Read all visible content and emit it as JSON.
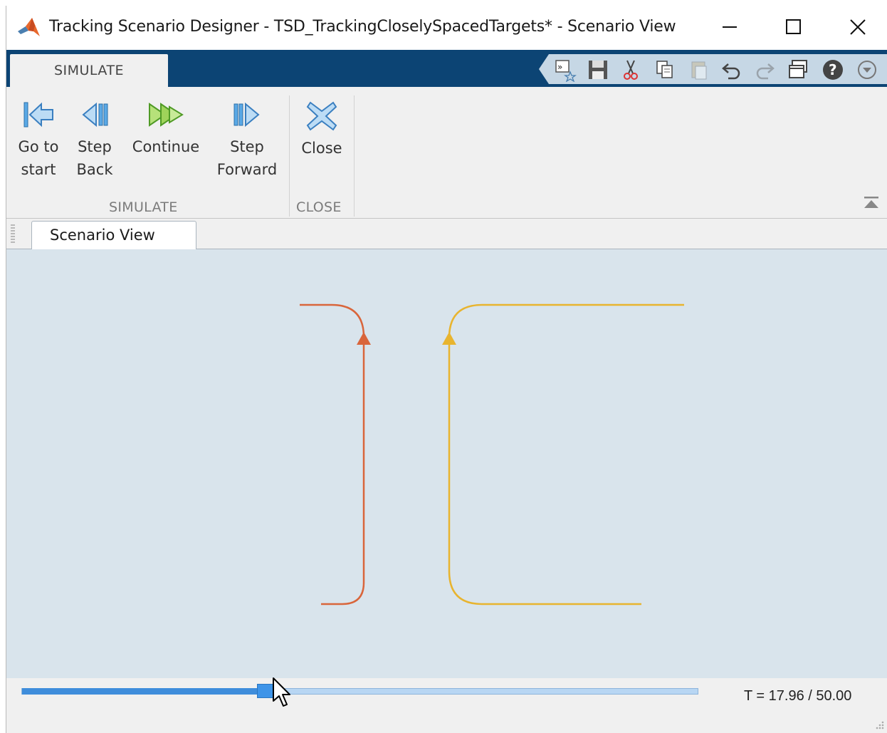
{
  "window": {
    "title": "Tracking Scenario Designer - TSD_TrackingCloselySpacedTargets* - Scenario View",
    "app_icon": "matlab-logo-icon",
    "controls": [
      "minimize-icon",
      "maximize-icon",
      "close-icon"
    ]
  },
  "ribbon": {
    "active_tab": "SIMULATE",
    "quick_access": [
      "help-browser-shortcut-icon",
      "save-icon",
      "cut-icon",
      "copy-icon",
      "paste-icon",
      "undo-icon",
      "redo-icon",
      "window-layout-icon",
      "help-icon",
      "expand-menu-icon"
    ],
    "groups": [
      {
        "label": "SIMULATE",
        "buttons": [
          {
            "line1": "Go to",
            "line2": "start",
            "icon": "go-to-start-icon"
          },
          {
            "line1": "Step",
            "line2": "Back",
            "icon": "step-back-icon"
          },
          {
            "line1": "Continue",
            "line2": "",
            "icon": "continue-icon"
          },
          {
            "line1": "Step",
            "line2": "Forward",
            "icon": "step-forward-icon"
          }
        ]
      },
      {
        "label": "CLOSE",
        "buttons": [
          {
            "line1": "Close",
            "line2": "",
            "icon": "close-x-icon"
          }
        ]
      }
    ]
  },
  "document": {
    "tab_label": "Scenario View"
  },
  "scenario": {
    "trajectories": [
      {
        "color": "#d9653b",
        "waypoints": [
          [
            -9,
            7
          ],
          [
            -6,
            7
          ],
          [
            -6,
            -7
          ],
          [
            -8,
            -7
          ]
        ],
        "direction": "up"
      },
      {
        "color": "#e8b42f",
        "waypoints": [
          [
            9,
            7
          ],
          [
            -2,
            7
          ],
          [
            -2,
            -7
          ],
          [
            7,
            -7
          ]
        ],
        "direction": "up"
      }
    ]
  },
  "timeline": {
    "current_time": 17.96,
    "end_time": 50.0,
    "readout": "T = 17.96 / 50.00"
  },
  "colors": {
    "ribbon_header": "#0c4474",
    "plot_background": "#d9e4ec",
    "slider_fill": "#3f8ddb",
    "target1": "#d9653b",
    "target2": "#e8b42f"
  }
}
